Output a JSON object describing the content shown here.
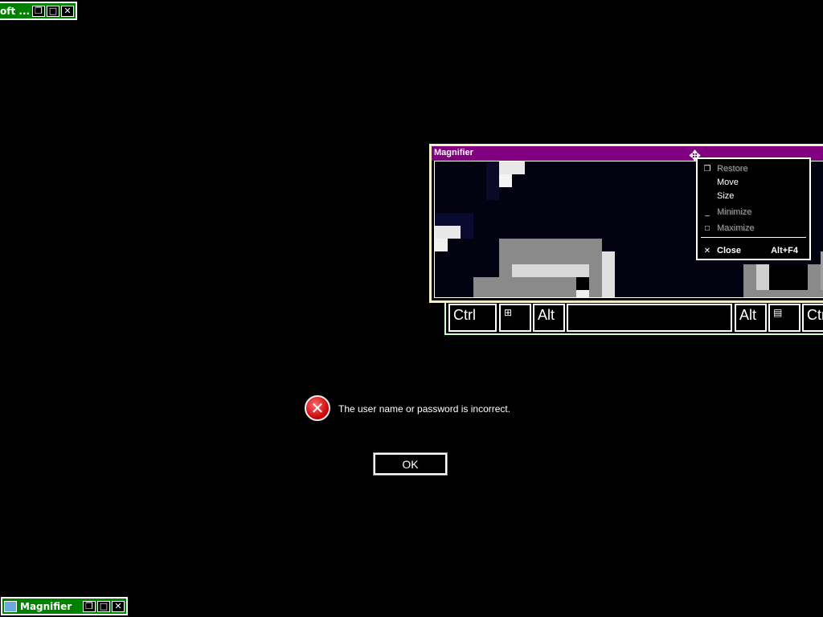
{
  "top_left_bar": {
    "caption": "oft ...",
    "buttons": [
      "restore",
      "maximize",
      "close"
    ]
  },
  "osk": {
    "keys": {
      "ctrl_left": "Ctrl",
      "alt_left": "Alt",
      "alt_right": "Alt",
      "ctrl_right": "Ctr"
    }
  },
  "magnifier": {
    "title": "Magnifier"
  },
  "system_menu": {
    "items": [
      {
        "label": "Restore",
        "enabled": false
      },
      {
        "label": "Move",
        "enabled": true
      },
      {
        "label": "Size",
        "enabled": true
      },
      {
        "label": "Minimize",
        "enabled": false
      },
      {
        "label": "Maximize",
        "enabled": false
      },
      {
        "label": "Close",
        "shortcut": "Alt+F4",
        "enabled": true
      }
    ]
  },
  "error": {
    "message": "The user name or password is incorrect.",
    "ok_label": "OK"
  },
  "taskbar_magnifier": {
    "caption": "Magnifier"
  },
  "colors": {
    "high_contrast_bg": "#000000",
    "magnifier_title": "#800080",
    "minimized_bar": "#008000",
    "error_red": "#c40000"
  }
}
